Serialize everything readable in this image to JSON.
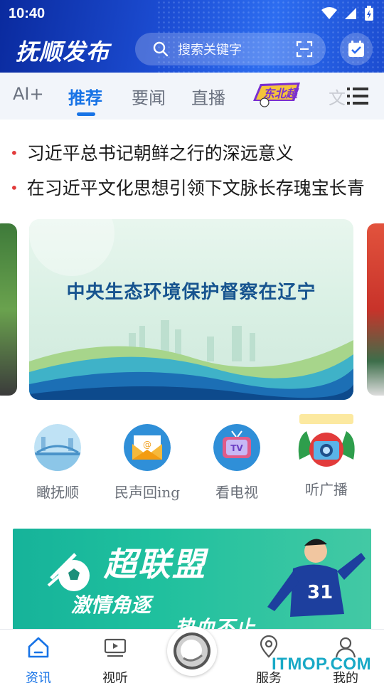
{
  "status_bar": {
    "time": "10:40"
  },
  "header": {
    "logo_text": "抚顺发布",
    "search_placeholder": "搜索关键字"
  },
  "tabs": {
    "items": [
      {
        "label": "AI+"
      },
      {
        "label": "推荐",
        "active": true
      },
      {
        "label": "要闻"
      },
      {
        "label": "直播"
      },
      {
        "label": "东北超",
        "image": true
      },
      {
        "label": "文"
      }
    ],
    "menu_icon": "menu-list-icon"
  },
  "headlines": [
    "习近平总书记朝鲜之行的深远意义",
    "在习近平文化思想引领下文脉长存瑰宝长青"
  ],
  "banner": {
    "title": "中央生态环境保护督察在辽宁"
  },
  "quick_links": [
    {
      "label": "瞰抚顺",
      "icon": "bridge-icon"
    },
    {
      "label": "民声回ing",
      "icon": "mail-icon"
    },
    {
      "label": "看电视",
      "icon": "tv-icon"
    },
    {
      "label": "听广播",
      "icon": "camera-photo-icon"
    }
  ],
  "promo": {
    "title": "超联盟",
    "line1": "激情角逐",
    "line2": "热血不止"
  },
  "bottom_nav": [
    {
      "label": "资讯",
      "icon": "home-icon",
      "active": true
    },
    {
      "label": "视听",
      "icon": "video-icon"
    },
    {
      "label": "服务",
      "icon": "location-icon"
    },
    {
      "label": "我的",
      "icon": "user-icon"
    }
  ],
  "watermark": "ITMOP.COM",
  "colors": {
    "accent": "#1773e6",
    "header_blue": "#1d4fd6",
    "headline_dot": "#e23b3b"
  }
}
